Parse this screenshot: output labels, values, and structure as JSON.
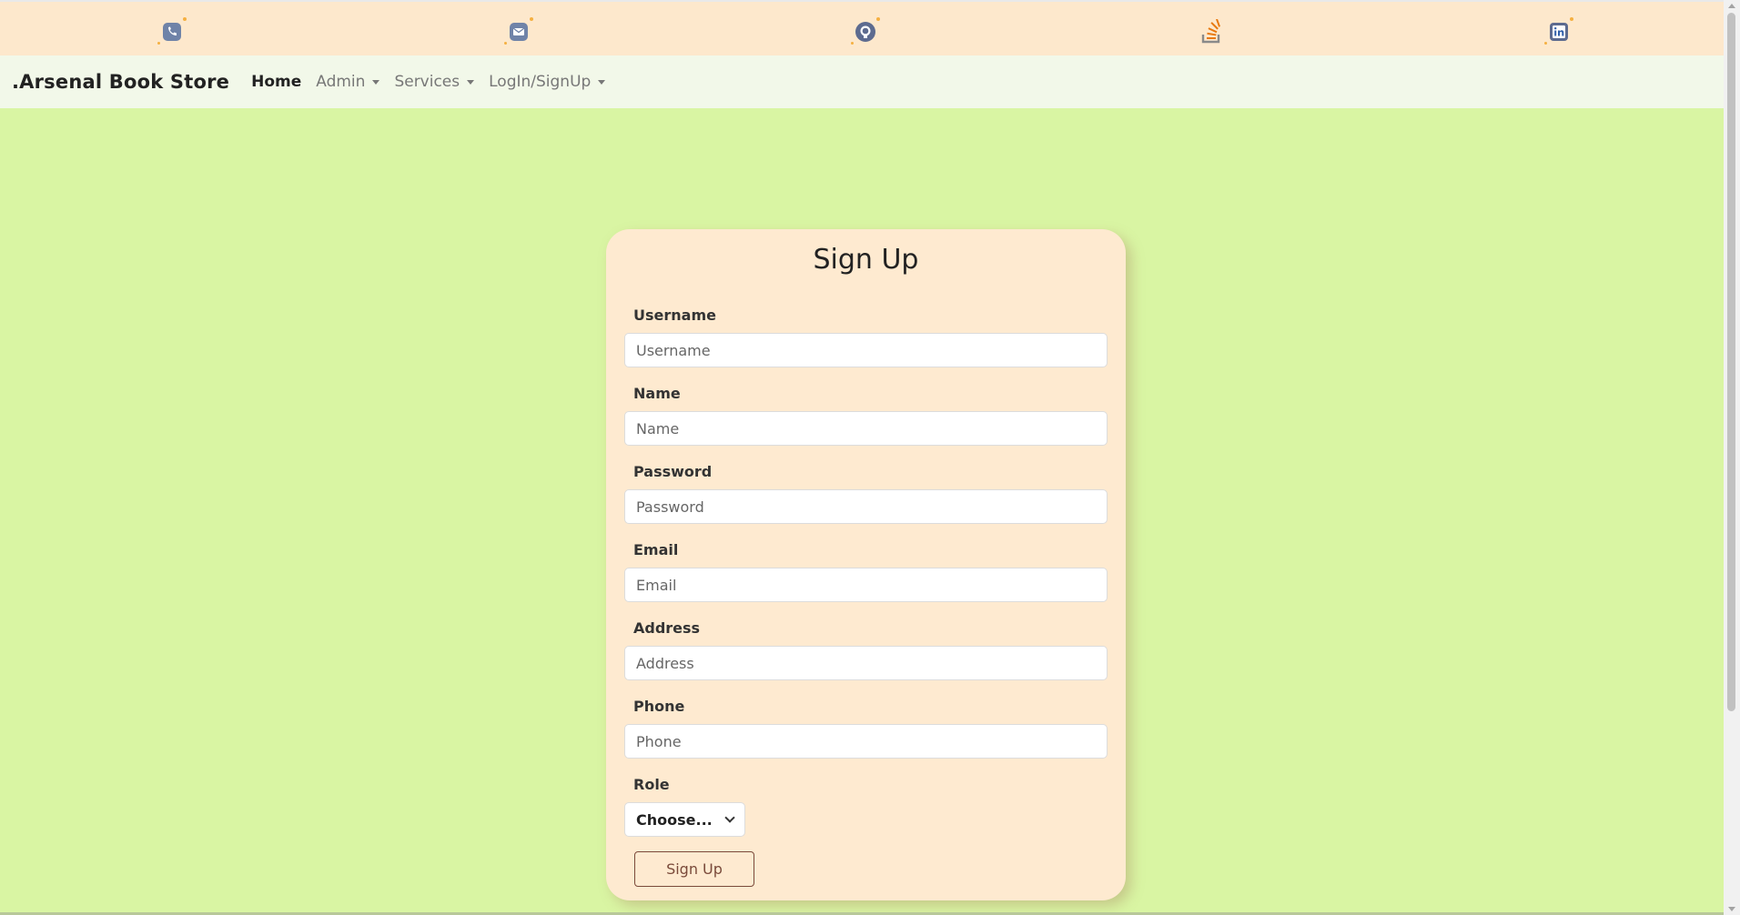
{
  "social": [
    {
      "icon": "phone-icon"
    },
    {
      "icon": "mail-icon"
    },
    {
      "icon": "github-icon"
    },
    {
      "icon": "stackoverflow-icon"
    },
    {
      "icon": "linkedin-icon"
    }
  ],
  "navbar": {
    "brand": ".Arsenal Book Store",
    "items": [
      {
        "label": "Home",
        "active": true
      },
      {
        "label": "Admin",
        "dropdown": true
      },
      {
        "label": "Services",
        "dropdown": true
      },
      {
        "label": "LogIn/SignUp",
        "dropdown": true
      }
    ]
  },
  "form": {
    "title": "Sign Up",
    "fields": [
      {
        "label": "Username",
        "placeholder": "Username"
      },
      {
        "label": "Name",
        "placeholder": "Name"
      },
      {
        "label": "Password",
        "placeholder": "Password"
      },
      {
        "label": "Email",
        "placeholder": "Email"
      },
      {
        "label": "Address",
        "placeholder": "Address"
      },
      {
        "label": "Phone",
        "placeholder": "Phone"
      }
    ],
    "role_label": "Role",
    "role_selected": "Choose...",
    "submit_label": "Sign Up"
  },
  "colors": {
    "page_bg": "#d9f5a3",
    "topbar_bg": "#fde8cc",
    "navbar_bg": "#f2f8e9",
    "card_bg": "#feead0",
    "button_border": "#7a4a3a"
  }
}
